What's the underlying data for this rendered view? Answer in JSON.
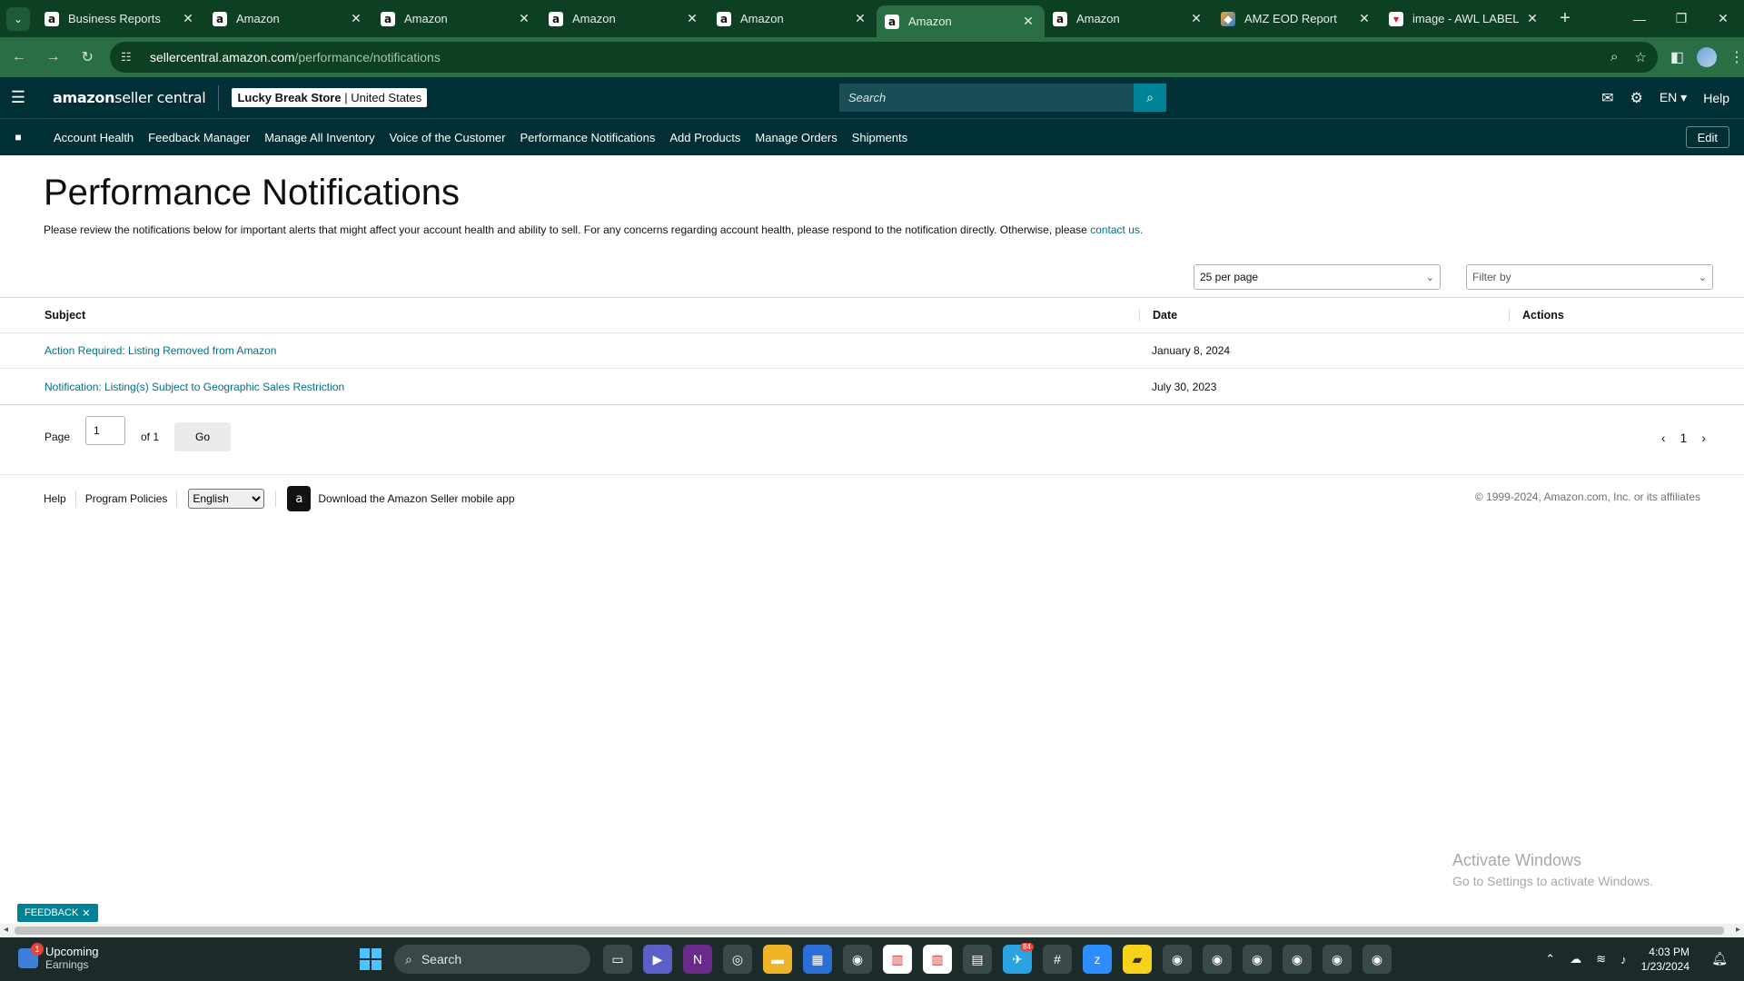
{
  "browser": {
    "tabs": [
      {
        "title": "Business Reports",
        "icon": "amazon-icon",
        "active": false
      },
      {
        "title": "Amazon",
        "icon": "amazon-icon",
        "active": false
      },
      {
        "title": "Amazon",
        "icon": "amazon-icon",
        "active": false
      },
      {
        "title": "Amazon",
        "icon": "amazon-icon",
        "active": false
      },
      {
        "title": "Amazon",
        "icon": "amazon-icon",
        "active": false
      },
      {
        "title": "Amazon",
        "icon": "amazon-icon",
        "active": true
      },
      {
        "title": "Amazon",
        "icon": "amazon-icon",
        "active": false
      },
      {
        "title": "AMZ EOD Report",
        "icon": "report-icon",
        "active": false
      },
      {
        "title": "image - AWL LABEL",
        "icon": "awl-icon",
        "active": false
      }
    ],
    "url_host": "sellercentral.amazon.com",
    "url_path": "/performance/notifications"
  },
  "header": {
    "logo_brand": "amazon",
    "logo_product": " seller central",
    "store_name": "Lucky Break Store",
    "store_sep": " | ",
    "store_region": "United States",
    "search_placeholder": "Search",
    "language": "EN",
    "help": "Help"
  },
  "navbar": {
    "links": [
      "Account Health",
      "Feedback Manager",
      "Manage All Inventory",
      "Voice of the Customer",
      "Performance Notifications",
      "Add Products",
      "Manage Orders",
      "Shipments"
    ],
    "edit_label": "Edit"
  },
  "main": {
    "title": "Performance Notifications",
    "description": "Please review the notifications below for important alerts that might affect your account health and ability to sell. For any concerns regarding account health, please respond to the notification directly. Otherwise, please ",
    "contact_link": "contact us.",
    "per_page": "25 per page",
    "filter_placeholder": "Filter by",
    "table": {
      "headers": {
        "subject": "Subject",
        "date": "Date",
        "actions": "Actions"
      },
      "rows": [
        {
          "subject": "Action Required: Listing Removed from Amazon",
          "date": "January 8, 2024",
          "actions": ""
        },
        {
          "subject": "Notification: Listing(s) Subject to Geographic Sales Restriction",
          "date": "July 30, 2023",
          "actions": ""
        }
      ]
    },
    "pager": {
      "label": "Page",
      "current": "1",
      "of": "of 1",
      "go": "Go",
      "page_number": "1"
    }
  },
  "footer": {
    "help": "Help",
    "policies": "Program Policies",
    "language_selected": "English",
    "app_download": "Download the Amazon Seller mobile app",
    "copyright": "© 1999-2024, Amazon.com, Inc. or its affiliates"
  },
  "overlay": {
    "activate_title": "Activate Windows",
    "activate_sub": "Go to Settings to activate Windows.",
    "feedback": "FEEDBACK"
  },
  "taskbar": {
    "weather_title": "Upcoming",
    "weather_sub": "Earnings",
    "weather_badge": "1",
    "search_label": "Search",
    "telegram_badge": "84",
    "time": "4:03 PM",
    "date": "1/23/2024"
  },
  "colors": {
    "chrome_dark": "#0d3f22",
    "chrome_tab": "#2a6e45",
    "seller_header": "#002f36",
    "link": "#007185",
    "search_button": "#008296"
  }
}
